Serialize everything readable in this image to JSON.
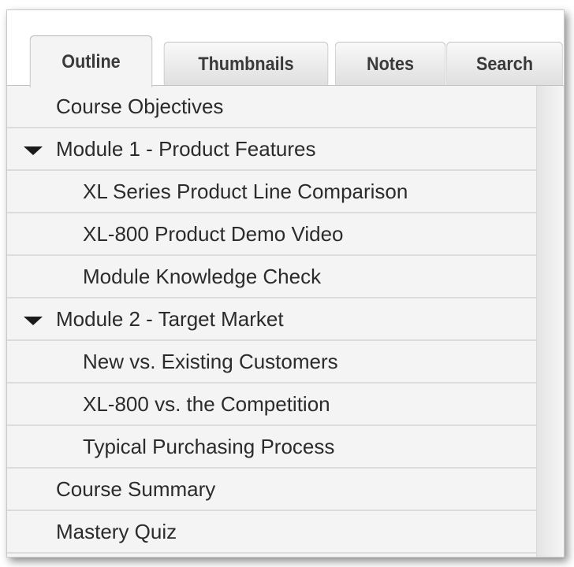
{
  "tabs": [
    {
      "label": "Outline",
      "active": true
    },
    {
      "label": "Thumbnails",
      "active": false
    },
    {
      "label": "Notes",
      "active": false
    },
    {
      "label": "Search",
      "active": false
    }
  ],
  "outline": [
    {
      "label": "Course Objectives",
      "level": 0
    },
    {
      "label": "Module 1 - Product Features",
      "level": 0,
      "expanded": true,
      "icon": "caret-down-icon"
    },
    {
      "label": "XL Series Product Line Comparison",
      "level": 1
    },
    {
      "label": "XL-800 Product Demo Video",
      "level": 1
    },
    {
      "label": "Module Knowledge Check",
      "level": 1
    },
    {
      "label": "Module 2 - Target Market",
      "level": 0,
      "expanded": true,
      "icon": "caret-down-icon"
    },
    {
      "label": "New vs. Existing Customers",
      "level": 1
    },
    {
      "label": "XL-800 vs. the Competition",
      "level": 1
    },
    {
      "label": "Typical Purchasing Process",
      "level": 1
    },
    {
      "label": "Course Summary",
      "level": 0
    },
    {
      "label": "Mastery Quiz",
      "level": 0
    }
  ],
  "colors": {
    "list_background": "#f4f4f4",
    "row_separator": "#dcdcdc",
    "text": "#2b2b2b"
  }
}
